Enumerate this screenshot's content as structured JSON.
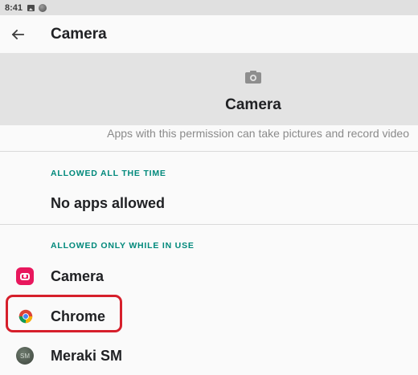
{
  "status_bar": {
    "time": "8:41",
    "icons": [
      "image-icon",
      "circle-app-icon"
    ]
  },
  "toolbar": {
    "back_icon": "arrow-left-icon",
    "title": "Camera"
  },
  "header": {
    "icon": "camera-icon",
    "title": "Camera",
    "description": "Apps with this permission can take pictures and record video"
  },
  "sections": {
    "allowed_all_time": {
      "header": "ALLOWED ALL THE TIME",
      "empty_text": "No apps allowed"
    },
    "allowed_while_in_use": {
      "header": "ALLOWED ONLY WHILE IN USE",
      "apps": [
        {
          "label": "Camera",
          "icon": "camera-app-icon"
        },
        {
          "label": "Chrome",
          "icon": "chrome-icon"
        },
        {
          "label": "Meraki SM",
          "icon": "meraki-sm-icon",
          "icon_text": "SM"
        }
      ]
    }
  },
  "colors": {
    "accent": "#00897b",
    "highlight": "#d61f2b",
    "header_bg": "#e3e3e3"
  }
}
